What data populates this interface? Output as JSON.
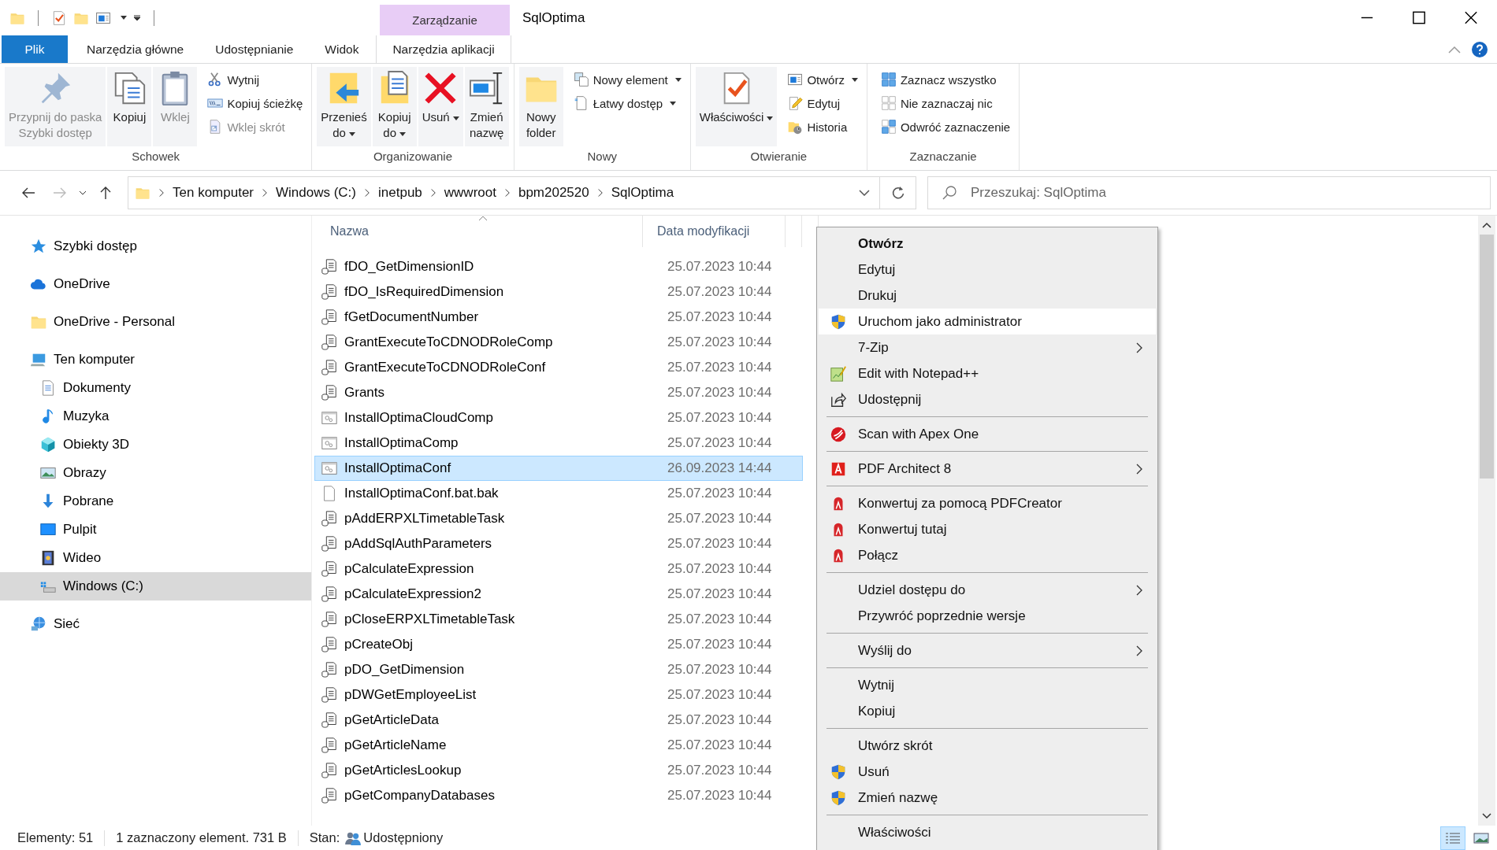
{
  "window": {
    "title": "SqlOptima",
    "context_tab_group": "Zarządzanie"
  },
  "ribbon_tabs": [
    {
      "label": "Plik",
      "kind": "file"
    },
    {
      "label": "Narzędzia główne",
      "kind": "tab"
    },
    {
      "label": "Udostępnianie",
      "kind": "tab"
    },
    {
      "label": "Widok",
      "kind": "tab"
    },
    {
      "label": "Narzędzia aplikacji",
      "kind": "context"
    }
  ],
  "ribbon_groups": [
    {
      "label": "Schowek",
      "buttons": [
        {
          "label": "Przypnij do paska\nSzybki dostęp",
          "kind": "large",
          "disabled": true,
          "dropdown": false
        },
        {
          "label": "Kopiuj",
          "kind": "large",
          "disabled": false,
          "dropdown": false
        },
        {
          "label": "Wklej",
          "kind": "large",
          "disabled": true,
          "dropdown": false
        },
        {
          "label": "Wytnij",
          "kind": "small",
          "disabled": false,
          "dropdown": false
        },
        {
          "label": "Kopiuj ścieżkę",
          "kind": "small",
          "disabled": false,
          "dropdown": false
        },
        {
          "label": "Wklej skrót",
          "kind": "small",
          "disabled": true,
          "dropdown": false
        }
      ]
    },
    {
      "label": "Organizowanie",
      "buttons": [
        {
          "label": "Przenieś\ndo",
          "kind": "large",
          "disabled": false,
          "dropdown": true
        },
        {
          "label": "Kopiuj\ndo",
          "kind": "large",
          "disabled": false,
          "dropdown": true
        },
        {
          "label": "Usuń",
          "kind": "large",
          "disabled": false,
          "dropdown": true
        },
        {
          "label": "Zmień\nnazwę",
          "kind": "large",
          "disabled": false,
          "dropdown": false
        }
      ]
    },
    {
      "label": "Nowy",
      "buttons": [
        {
          "label": "Nowy\nfolder",
          "kind": "large",
          "disabled": false,
          "dropdown": false
        },
        {
          "label": "Nowy element",
          "kind": "small",
          "disabled": false,
          "dropdown": true
        },
        {
          "label": "Łatwy dostęp",
          "kind": "small",
          "disabled": false,
          "dropdown": true
        }
      ]
    },
    {
      "label": "Otwieranie",
      "buttons": [
        {
          "label": "Właściwości",
          "kind": "large",
          "disabled": false,
          "dropdown": true
        },
        {
          "label": "Otwórz",
          "kind": "small",
          "disabled": false,
          "dropdown": true
        },
        {
          "label": "Edytuj",
          "kind": "small",
          "disabled": false,
          "dropdown": false
        },
        {
          "label": "Historia",
          "kind": "small",
          "disabled": false,
          "dropdown": false
        }
      ]
    },
    {
      "label": "Zaznaczanie",
      "buttons": [
        {
          "label": "Zaznacz wszystko",
          "kind": "small",
          "disabled": false,
          "dropdown": false
        },
        {
          "label": "Nie zaznaczaj nic",
          "kind": "small",
          "disabled": false,
          "dropdown": false
        },
        {
          "label": "Odwróć zaznaczenie",
          "kind": "small",
          "disabled": false,
          "dropdown": false
        }
      ]
    }
  ],
  "address": {
    "path": [
      "Ten komputer",
      "Windows (C:)",
      "inetpub",
      "wwwroot",
      "bpm202520",
      "SqlOptima"
    ]
  },
  "search": {
    "placeholder": "Przeszukaj: SqlOptima"
  },
  "navigation": [
    {
      "label": "Szybki dostęp",
      "selected": false
    },
    {
      "label": "OneDrive",
      "selected": false
    },
    {
      "label": "OneDrive - Personal",
      "selected": false
    },
    {
      "label": "Ten komputer",
      "selected": false,
      "children": [
        {
          "label": "Dokumenty",
          "selected": false
        },
        {
          "label": "Muzyka",
          "selected": false
        },
        {
          "label": "Obiekty 3D",
          "selected": false
        },
        {
          "label": "Obrazy",
          "selected": false
        },
        {
          "label": "Pobrane",
          "selected": false
        },
        {
          "label": "Pulpit",
          "selected": false
        },
        {
          "label": "Wideo",
          "selected": false
        },
        {
          "label": "Windows (C:)",
          "selected": true
        }
      ]
    },
    {
      "label": "Sieć",
      "selected": false
    }
  ],
  "columns": [
    {
      "label": "Nazwa",
      "sorted": true
    },
    {
      "label": "Data modyfikacji",
      "sorted": false
    }
  ],
  "files": [
    {
      "name": "fDO_GetDimensionID",
      "date": "25.07.2023 10:44",
      "kind": "script",
      "selected": false
    },
    {
      "name": "fDO_IsRequiredDimension",
      "date": "25.07.2023 10:44",
      "kind": "script",
      "selected": false
    },
    {
      "name": "fGetDocumentNumber",
      "date": "25.07.2023 10:44",
      "kind": "script",
      "selected": false
    },
    {
      "name": "GrantExecuteToCDNODRoleComp",
      "date": "25.07.2023 10:44",
      "kind": "script",
      "selected": false
    },
    {
      "name": "GrantExecuteToCDNODRoleConf",
      "date": "25.07.2023 10:44",
      "kind": "script",
      "selected": false
    },
    {
      "name": "Grants",
      "date": "25.07.2023 10:44",
      "kind": "script",
      "selected": false
    },
    {
      "name": "InstallOptimaCloudComp",
      "date": "25.07.2023 10:44",
      "kind": "batch",
      "selected": false
    },
    {
      "name": "InstallOptimaComp",
      "date": "25.07.2023 10:44",
      "kind": "batch",
      "selected": false
    },
    {
      "name": "InstallOptimaConf",
      "date": "26.09.2023 14:44",
      "kind": "batch",
      "selected": true
    },
    {
      "name": "InstallOptimaConf.bat.bak",
      "date": "25.07.2023 10:44",
      "kind": "blank",
      "selected": false
    },
    {
      "name": "pAddERPXLTimetableTask",
      "date": "25.07.2023 10:44",
      "kind": "script",
      "selected": false
    },
    {
      "name": "pAddSqlAuthParameters",
      "date": "25.07.2023 10:44",
      "kind": "script",
      "selected": false
    },
    {
      "name": "pCalculateExpression",
      "date": "25.07.2023 10:44",
      "kind": "script",
      "selected": false
    },
    {
      "name": "pCalculateExpression2",
      "date": "25.07.2023 10:44",
      "kind": "script",
      "selected": false
    },
    {
      "name": "pCloseERPXLTimetableTask",
      "date": "25.07.2023 10:44",
      "kind": "script",
      "selected": false
    },
    {
      "name": "pCreateObj",
      "date": "25.07.2023 10:44",
      "kind": "script",
      "selected": false
    },
    {
      "name": "pDO_GetDimension",
      "date": "25.07.2023 10:44",
      "kind": "script",
      "selected": false
    },
    {
      "name": "pDWGetEmployeeList",
      "date": "25.07.2023 10:44",
      "kind": "script",
      "selected": false
    },
    {
      "name": "pGetArticleData",
      "date": "25.07.2023 10:44",
      "kind": "script",
      "selected": false
    },
    {
      "name": "pGetArticleName",
      "date": "25.07.2023 10:44",
      "kind": "script",
      "selected": false
    },
    {
      "name": "pGetArticlesLookup",
      "date": "25.07.2023 10:44",
      "kind": "script",
      "selected": false
    },
    {
      "name": "pGetCompanyDatabases",
      "date": "25.07.2023 10:44",
      "kind": "script",
      "selected": false
    }
  ],
  "context_menu": [
    [
      {
        "label": "Otwórz",
        "default": true,
        "submenu": false,
        "selected": false
      },
      {
        "label": "Edytuj",
        "default": false,
        "submenu": false,
        "selected": false
      },
      {
        "label": "Drukuj",
        "default": false,
        "submenu": false,
        "selected": false
      },
      {
        "label": "Uruchom jako administrator",
        "default": false,
        "submenu": false,
        "selected": true
      },
      {
        "label": "7-Zip",
        "default": false,
        "submenu": true,
        "selected": false
      },
      {
        "label": "Edit with Notepad++",
        "default": false,
        "submenu": false,
        "selected": false
      },
      {
        "label": "Udostępnij",
        "default": false,
        "submenu": false,
        "selected": false
      }
    ],
    [
      {
        "label": "Scan with Apex One",
        "default": false,
        "submenu": false,
        "selected": false
      }
    ],
    [
      {
        "label": "PDF Architect 8",
        "default": false,
        "submenu": true,
        "selected": false
      }
    ],
    [
      {
        "label": "Konwertuj za pomocą PDFCreator",
        "default": false,
        "submenu": false,
        "selected": false
      },
      {
        "label": "Konwertuj tutaj",
        "default": false,
        "submenu": false,
        "selected": false
      },
      {
        "label": "Połącz",
        "default": false,
        "submenu": false,
        "selected": false
      }
    ],
    [
      {
        "label": "Udziel dostępu do",
        "default": false,
        "submenu": true,
        "selected": false
      },
      {
        "label": "Przywróć poprzednie wersje",
        "default": false,
        "submenu": false,
        "selected": false
      }
    ],
    [
      {
        "label": "Wyślij do",
        "default": false,
        "submenu": true,
        "selected": false
      }
    ],
    [
      {
        "label": "Wytnij",
        "default": false,
        "submenu": false,
        "selected": false
      },
      {
        "label": "Kopiuj",
        "default": false,
        "submenu": false,
        "selected": false
      }
    ],
    [
      {
        "label": "Utwórz skrót",
        "default": false,
        "submenu": false,
        "selected": false
      },
      {
        "label": "Usuń",
        "default": false,
        "submenu": false,
        "selected": false
      },
      {
        "label": "Zmień nazwę",
        "default": false,
        "submenu": false,
        "selected": false
      }
    ],
    [
      {
        "label": "Właściwości",
        "default": false,
        "submenu": false,
        "selected": false
      }
    ]
  ],
  "status_bar": {
    "item_count": "Elementy: 51",
    "selection": "1 zaznaczony element. 731 B",
    "state_label": "Stan:",
    "state_value": "Udostępniony"
  },
  "view_buttons": [
    {
      "kind": "details",
      "selected": true
    },
    {
      "kind": "large-icons",
      "selected": false
    }
  ]
}
